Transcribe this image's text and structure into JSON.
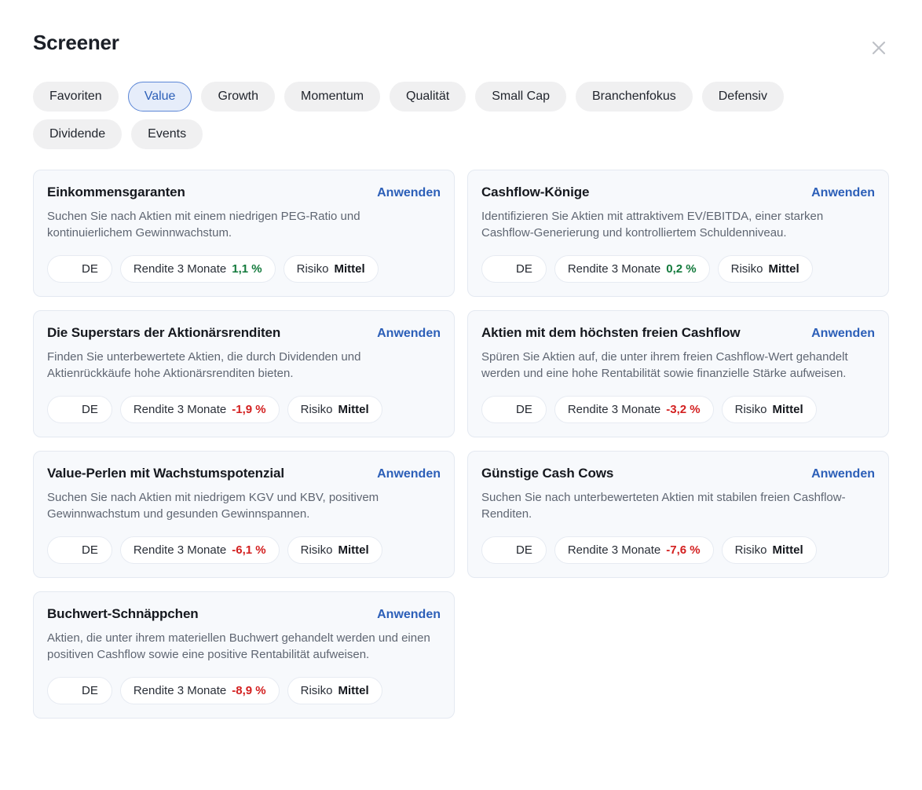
{
  "header": {
    "title": "Screener",
    "close_icon": "close-icon"
  },
  "filters": {
    "chips": [
      {
        "label": "Favoriten",
        "active": false
      },
      {
        "label": "Value",
        "active": true
      },
      {
        "label": "Growth",
        "active": false
      },
      {
        "label": "Momentum",
        "active": false
      },
      {
        "label": "Qualität",
        "active": false
      },
      {
        "label": "Small Cap",
        "active": false
      },
      {
        "label": "Branchenfokus",
        "active": false
      },
      {
        "label": "Defensiv",
        "active": false
      },
      {
        "label": "Dividende",
        "active": false
      },
      {
        "label": "Events",
        "active": false
      }
    ]
  },
  "common": {
    "apply_label": "Anwenden",
    "return_label": "Rendite 3 Monate",
    "risk_label": "Risiko",
    "country_code": "DE",
    "flag_icon": "flag-de-icon"
  },
  "colors": {
    "accent": "#2c5fb8",
    "positive": "#137a3c",
    "negative": "#d32020",
    "card_bg": "#f7f9fc",
    "chip_bg": "#f0f0f1",
    "chip_active_bg": "#e6edfa"
  },
  "cards": [
    {
      "title": "Einkommensgaranten",
      "apply": "Anwenden",
      "description": "Suchen Sie nach Aktien mit einem niedrigen PEG-Ratio und kontinuierlichem Gewinnwachstum.",
      "country": "DE",
      "return_label": "Rendite 3 Monate",
      "return_value": "1,1 %",
      "return_sign": "positive",
      "risk_label": "Risiko",
      "risk_value": "Mittel"
    },
    {
      "title": "Cashflow-Könige",
      "apply": "Anwenden",
      "description": "Identifizieren Sie Aktien mit attraktivem EV/EBITDA, einer starken Cashflow-Generierung und kontrolliertem Schuldenniveau.",
      "country": "DE",
      "return_label": "Rendite 3 Monate",
      "return_value": "0,2 %",
      "return_sign": "positive",
      "risk_label": "Risiko",
      "risk_value": "Mittel"
    },
    {
      "title": "Die Superstars der Aktionärsrenditen",
      "apply": "Anwenden",
      "description": "Finden Sie unterbewertete Aktien, die durch Dividenden und Aktienrückkäufe hohe Aktionärsrenditen bieten.",
      "country": "DE",
      "return_label": "Rendite 3 Monate",
      "return_value": "-1,9 %",
      "return_sign": "negative",
      "risk_label": "Risiko",
      "risk_value": "Mittel"
    },
    {
      "title": "Aktien mit dem höchsten freien Cashflow",
      "apply": "Anwenden",
      "description": "Spüren Sie Aktien auf, die unter ihrem freien Cashflow-Wert gehandelt werden und eine hohe Rentabilität sowie finanzielle Stärke aufweisen.",
      "country": "DE",
      "return_label": "Rendite 3 Monate",
      "return_value": "-3,2 %",
      "return_sign": "negative",
      "risk_label": "Risiko",
      "risk_value": "Mittel"
    },
    {
      "title": "Value-Perlen mit Wachstumspotenzial",
      "apply": "Anwenden",
      "description": "Suchen Sie nach Aktien mit niedrigem KGV und KBV, positivem Gewinnwachstum und gesunden Gewinnspannen.",
      "country": "DE",
      "return_label": "Rendite 3 Monate",
      "return_value": "-6,1 %",
      "return_sign": "negative",
      "risk_label": "Risiko",
      "risk_value": "Mittel"
    },
    {
      "title": "Günstige Cash Cows",
      "apply": "Anwenden",
      "description": "Suchen Sie nach unterbewerteten Aktien mit stabilen freien Cashflow-Renditen.",
      "country": "DE",
      "return_label": "Rendite 3 Monate",
      "return_value": "-7,6 %",
      "return_sign": "negative",
      "risk_label": "Risiko",
      "risk_value": "Mittel"
    },
    {
      "title": "Buchwert-Schnäppchen",
      "apply": "Anwenden",
      "description": "Aktien, die unter ihrem materiellen Buchwert gehandelt werden und einen positiven Cashflow sowie eine positive Rentabilität aufweisen.",
      "country": "DE",
      "return_label": "Rendite 3 Monate",
      "return_value": "-8,9 %",
      "return_sign": "negative",
      "risk_label": "Risiko",
      "risk_value": "Mittel"
    }
  ]
}
